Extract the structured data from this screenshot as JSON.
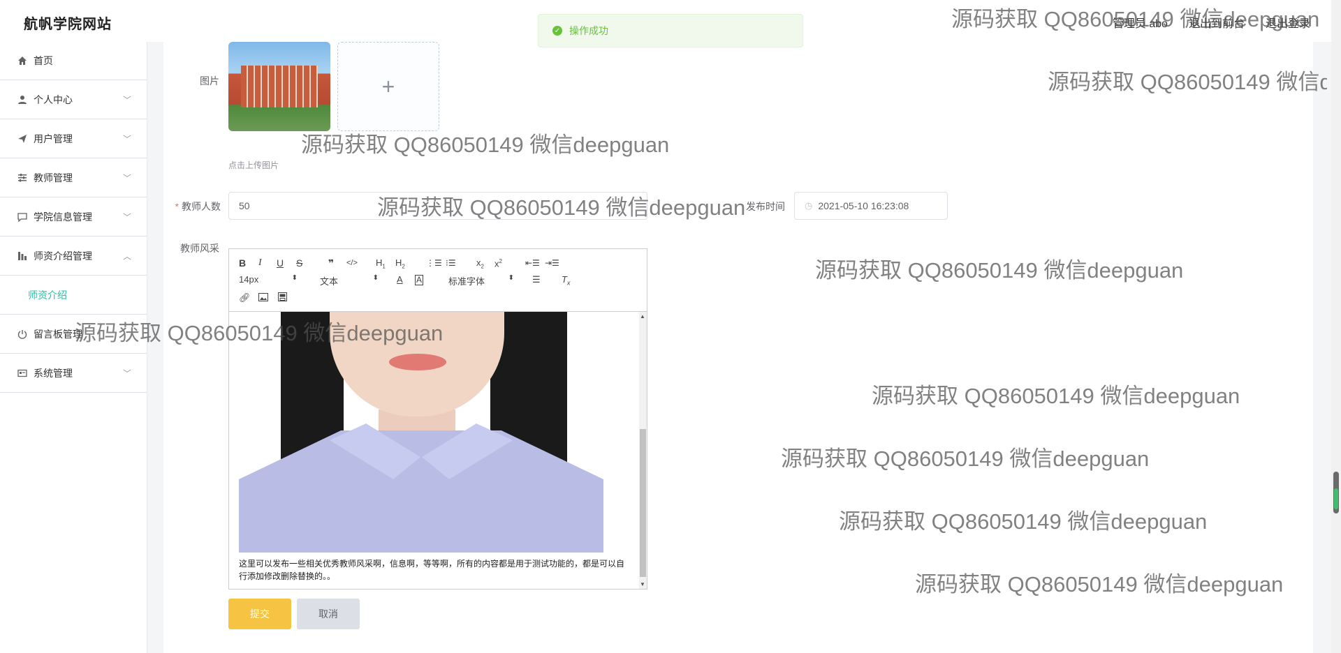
{
  "header": {
    "logo": "航帆学院网站",
    "user_label": "管理员 abo",
    "exit_frontend": "退出到前台",
    "logout": "退出登录"
  },
  "toast": {
    "message": "操作成功"
  },
  "sidebar": {
    "items": [
      {
        "label": "首页"
      },
      {
        "label": "个人中心"
      },
      {
        "label": "用户管理"
      },
      {
        "label": "教师管理"
      },
      {
        "label": "学院信息管理"
      },
      {
        "label": "师资介绍管理"
      },
      {
        "label": "留言板管理"
      },
      {
        "label": "系统管理"
      }
    ],
    "submenu_active": "师资介绍"
  },
  "form": {
    "image_label": "图片",
    "upload_tip": "点击上传图片",
    "teacher_count_label": "教师人数",
    "teacher_count_value": "50",
    "publish_time_label": "发布时间",
    "publish_time_value": "2021-05-10 16:23:08",
    "style_label": "教师风采",
    "submit": "提交",
    "cancel": "取消"
  },
  "editor": {
    "font_size": "14px",
    "block_type": "文本",
    "font_family": "标准字体",
    "content_text": "这里可以发布一些相关优秀教师风采啊，信息啊，等等啊，所有的内容都是用于测试功能的，都是可以自行添加修改删除替换的。。"
  },
  "watermark": "源码获取 QQ86050149 微信deepguan"
}
